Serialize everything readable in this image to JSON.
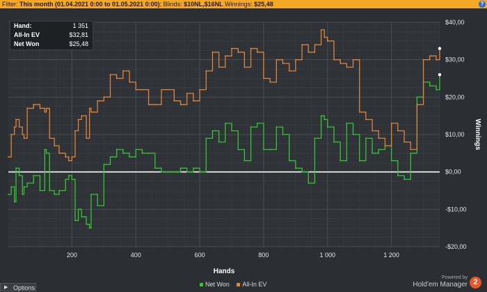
{
  "filter_bar": {
    "prefix": "Filter: ",
    "range": "This month (01.04.2021 0:00 to 01.05.2021 0:00)",
    "blinds_label": "; Blinds: ",
    "blinds": "$10NL,$16NL",
    "winnings_label": " Winnings: ",
    "winnings": "$25,48",
    "help_icon": "?"
  },
  "stats_box": {
    "rows": [
      {
        "label": "Hand:",
        "value": "1 351"
      },
      {
        "label": "All-In EV",
        "value": "$32,81"
      },
      {
        "label": "Net Won",
        "value": "$25,48"
      }
    ]
  },
  "footer": {
    "options_label": "Options",
    "powered_by": "Powered by",
    "brand": "Hold'em Manager",
    "logo_text": "2"
  },
  "colors": {
    "net_won": "#35c535",
    "all_in_ev": "#e0853a",
    "background": "#2b2e33",
    "zero_line": "#ffffff"
  },
  "chart_data": {
    "type": "line",
    "xlabel": "Hands",
    "ylabel": "Winnings",
    "xlim": [
      1,
      1351
    ],
    "ylim": [
      -20,
      40
    ],
    "x_ticks": [
      200,
      400,
      600,
      800,
      1000,
      1200
    ],
    "x_tick_labels": [
      "200",
      "400",
      "600",
      "800",
      "1 000",
      "1 200"
    ],
    "y_ticks": [
      -20,
      -10,
      0,
      10,
      20,
      30,
      40
    ],
    "y_tick_labels": [
      "-$20,00",
      "-$10,00",
      "$0,00",
      "$10,00",
      "$20,00",
      "$30,00",
      "$40,00"
    ],
    "grid": true,
    "legend_position": "bottom",
    "series": [
      {
        "name": "Net Won",
        "color": "#35c535",
        "x": [
          1,
          10,
          20,
          25,
          35,
          45,
          50,
          60,
          80,
          100,
          115,
          120,
          130,
          145,
          160,
          180,
          190,
          200,
          210,
          220,
          230,
          245,
          255,
          260,
          280,
          300,
          320,
          340,
          360,
          380,
          400,
          420,
          440,
          460,
          480,
          500,
          520,
          540,
          560,
          580,
          600,
          620,
          640,
          660,
          680,
          700,
          720,
          740,
          760,
          780,
          800,
          820,
          840,
          860,
          880,
          900,
          920,
          940,
          960,
          980,
          990,
          1000,
          1020,
          1040,
          1060,
          1080,
          1100,
          1120,
          1140,
          1160,
          1180,
          1200,
          1220,
          1240,
          1260,
          1280,
          1300,
          1320,
          1340,
          1351
        ],
        "y": [
          -6,
          -4,
          -8,
          1,
          -1,
          -6,
          -4,
          -3,
          -1,
          -5,
          6,
          5,
          -5,
          -6,
          -5,
          -2,
          -1,
          -2,
          -13,
          -10,
          -12,
          -14,
          -15,
          -6,
          -9,
          2,
          4,
          6,
          5,
          4,
          6,
          5,
          5,
          1,
          0,
          0,
          0,
          1,
          0,
          1,
          0,
          9,
          11,
          8,
          13,
          11,
          6,
          3,
          12,
          13,
          6,
          6,
          12,
          10,
          3,
          1,
          0,
          -3,
          9,
          15,
          14,
          12,
          8,
          3,
          13,
          10,
          3,
          9,
          5,
          6,
          7,
          3,
          -1,
          -2,
          5,
          20,
          24,
          23,
          22,
          26
        ]
      },
      {
        "name": "All-In EV",
        "color": "#e0853a",
        "x": [
          1,
          10,
          20,
          25,
          35,
          45,
          50,
          60,
          80,
          100,
          115,
          120,
          130,
          145,
          160,
          180,
          190,
          200,
          210,
          220,
          230,
          245,
          255,
          260,
          280,
          300,
          320,
          340,
          360,
          380,
          400,
          420,
          440,
          460,
          480,
          500,
          520,
          540,
          560,
          580,
          600,
          620,
          640,
          660,
          680,
          700,
          720,
          740,
          760,
          780,
          800,
          820,
          840,
          860,
          880,
          900,
          920,
          940,
          960,
          980,
          990,
          1000,
          1020,
          1040,
          1060,
          1080,
          1100,
          1120,
          1140,
          1160,
          1180,
          1200,
          1220,
          1240,
          1260,
          1280,
          1300,
          1320,
          1340,
          1351
        ],
        "y": [
          4,
          10,
          12,
          14,
          12,
          10,
          9,
          17,
          18,
          17,
          16,
          17,
          9,
          7,
          5,
          4,
          3,
          4,
          11,
          14,
          15,
          9,
          17,
          16,
          19,
          20,
          26,
          25,
          27,
          24,
          22,
          22,
          18,
          18,
          22,
          22,
          19,
          18,
          21,
          19,
          22,
          27,
          32,
          28,
          31,
          33,
          32,
          28,
          33,
          32,
          25,
          24,
          30,
          29,
          27,
          30,
          34,
          32,
          34,
          38,
          36,
          35,
          30,
          29,
          28,
          30,
          16,
          14,
          11,
          9,
          7,
          13,
          11,
          8,
          6,
          18,
          30,
          31,
          30,
          33
        ]
      }
    ]
  }
}
